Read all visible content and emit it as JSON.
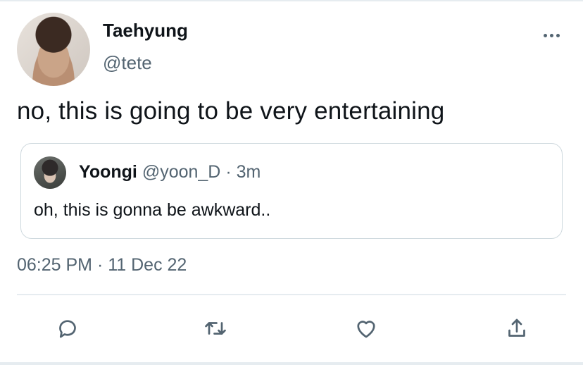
{
  "tweet": {
    "author_name": "Taehyung",
    "author_handle": "@tete",
    "text": "no, this is going to be very entertaining",
    "timestamp": "06:25 PM · 11 Dec 22"
  },
  "quoted_tweet": {
    "author_name": "Yoongi",
    "author_handle": "@yoon_D",
    "separator": " · ",
    "time_ago": "3m",
    "text": "oh, this is gonna be awkward.."
  },
  "actions": [
    "reply-icon",
    "retweet-icon",
    "like-icon",
    "share-icon"
  ],
  "colors": {
    "text": "#0f1419",
    "secondary": "#536471",
    "border": "#cfd9de",
    "divider": "#e6ecf0"
  }
}
